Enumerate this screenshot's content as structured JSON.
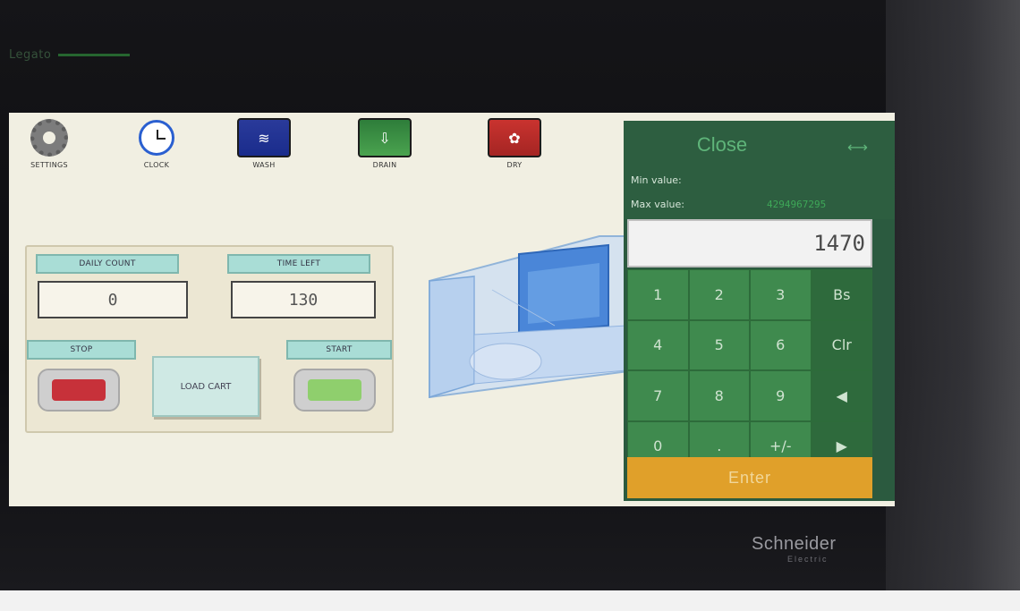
{
  "device": {
    "top_left_label": "Legato",
    "brand": "Schneider",
    "brand_sub": "Electric"
  },
  "nav": {
    "items": [
      {
        "label": "SETTINGS",
        "icon": "gear-icon"
      },
      {
        "label": "CLOCK",
        "icon": "clock-icon"
      },
      {
        "label": "WASH",
        "icon": "wash-icon"
      },
      {
        "label": "DRAIN",
        "icon": "drain-icon"
      },
      {
        "label": "DRY",
        "icon": "dry-icon"
      }
    ]
  },
  "panel": {
    "daily_count_label": "DAILY COUNT",
    "daily_count_value": "0",
    "time_left_label": "TIME LEFT",
    "time_left_value": "130",
    "stop_label": "STOP",
    "start_label": "START",
    "load_cart_label": "LOAD CART"
  },
  "keypad": {
    "close_label": "Close",
    "min_label": "Min value:",
    "max_label": "Max value:",
    "max_value": "4294967295",
    "display_value": "1470",
    "keys": [
      "1",
      "2",
      "3",
      "Bs",
      "4",
      "5",
      "6",
      "Clr",
      "7",
      "8",
      "9",
      "◀",
      "0",
      ".",
      "+/-",
      "▶"
    ],
    "enter_label": "Enter"
  },
  "colors": {
    "screen_bg": "#f1efe2",
    "keypad_green": "#3f8a4e",
    "enter_orange": "#e0a02a",
    "stop_red": "#c7313a",
    "start_green": "#8fcf6d"
  }
}
